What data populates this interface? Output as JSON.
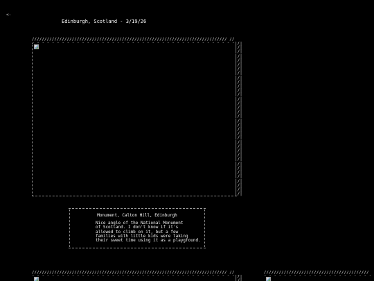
{
  "nav": {
    "back_label": "<-"
  },
  "page": {
    "title": "Edinburgh, Scotland - 3/19/26"
  },
  "photo": {
    "frame_top": "////////////////////////////////////////////////////////////////////////////// //",
    "frame_dash": "- - - - - - - - - - - - - - - - - - - - - - - - - - - - - - - - - - - - - - - - - - - -",
    "frame_right": "|/|\n|/|\n|/|\n|/|\n|/|\n|/|\n|/|\n|/|\n|/|\n|/|\n|/|\n|/|\n|/|\n|/|\n|/|\n|/|\n|/|\n|/|\n|/|\n|/|\n|/|\n|/|\n|/|\n|/|\n|/|\n|/|\n|/|\n|/|\n|/|\n|/|\n|/|\n|/|\n|/|\n|/|\n|/|\n|/|",
    "image_state": "broken-image-icon"
  },
  "caption": {
    "title": "Monument, Calton Hill, Edinburgh",
    "body": "Nice angle of the National Monument\nof Scotland. I don't know if it's\nallowed to climb on it, but a few\nfamilies with little kids were taking\ntheir sweet time using it as a playground."
  },
  "next_photos": [
    {
      "frame_top": "////////////////////////////////////////////////////////////////////////////// //",
      "frame_dash": "- - - - - - - - - - - - - - - - - - - - - - - - - - - - - - - - - - - - - - - - - - - -",
      "frame_right": "|/|\n|/|"
    },
    {
      "frame_top": "//////////////////////////////////////////",
      "frame_dash": "- - - - - - - - - - - - - - - - - - - - - -"
    }
  ]
}
